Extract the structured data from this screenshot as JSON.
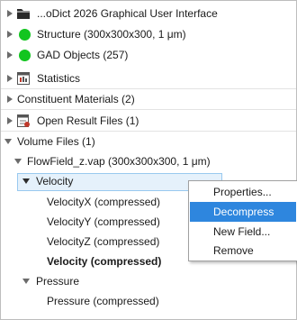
{
  "tree": {
    "root_label": "...oDict 2026 Graphical User Interface",
    "structure_label": "Structure (300x300x300, 1 μm)",
    "gad_label": "GAD Objects (257)",
    "statistics_label": "Statistics",
    "constituent_label": "Constituent Materials (2)",
    "result_files_label": "Open Result Files (1)",
    "volume_files_label": "Volume Files (1)",
    "flowfield_label": "FlowField_z.vap (300x300x300, 1 μm)",
    "velocity_label": "Velocity",
    "velocity_x_label": "VelocityX (compressed)",
    "velocity_y_label": "VelocityY (compressed)",
    "velocity_z_label": "VelocityZ (compressed)",
    "velocity_compressed_label": "Velocity (compressed)",
    "pressure_label": "Pressure",
    "pressure_compressed_label": "Pressure (compressed)"
  },
  "context_menu": {
    "properties": "Properties...",
    "decompress": "Decompress",
    "new_field": "New Field...",
    "remove": "Remove"
  },
  "colors": {
    "status_green": "#12c51f",
    "selection_bg": "#e5f1fb",
    "menu_highlight": "#2e86de"
  }
}
